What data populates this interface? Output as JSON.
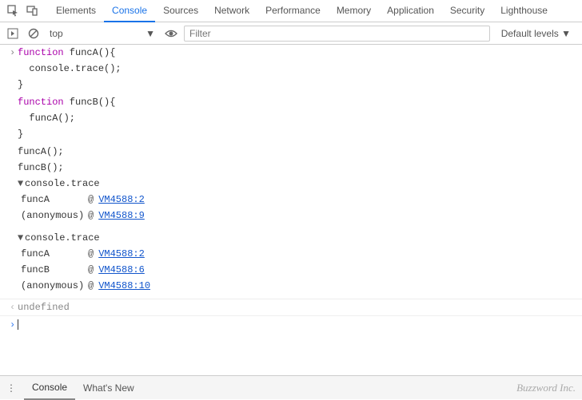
{
  "tabs": [
    "Elements",
    "Console",
    "Sources",
    "Network",
    "Performance",
    "Memory",
    "Application",
    "Security",
    "Lighthouse"
  ],
  "active_tab": "Console",
  "toolbar": {
    "context": "top",
    "filter_placeholder": "Filter",
    "levels": "Default levels"
  },
  "code": {
    "l1a": "function",
    "l1b": " funcA(){",
    "l2": "  console.trace();",
    "l3": "}",
    "l4": "",
    "l5a": "function",
    "l5b": " funcB(){",
    "l6": "  funcA();",
    "l7": "}",
    "l8": "",
    "l9": "funcA();",
    "l10": "funcB();"
  },
  "traces": [
    {
      "header": "console.trace",
      "frames": [
        {
          "fn": "funcA",
          "at": "@",
          "loc": "VM4588:2"
        },
        {
          "fn": "(anonymous)",
          "at": "@",
          "loc": "VM4588:9"
        }
      ]
    },
    {
      "header": "console.trace",
      "frames": [
        {
          "fn": "funcA",
          "at": "@",
          "loc": "VM4588:2"
        },
        {
          "fn": "funcB",
          "at": "@",
          "loc": "VM4588:6"
        },
        {
          "fn": "(anonymous)",
          "at": "@",
          "loc": "VM4588:10"
        }
      ]
    }
  ],
  "result": "undefined",
  "drawer": {
    "tabs": [
      "Console",
      "What's New"
    ],
    "active": "Console"
  },
  "brand": "Buzzword Inc."
}
